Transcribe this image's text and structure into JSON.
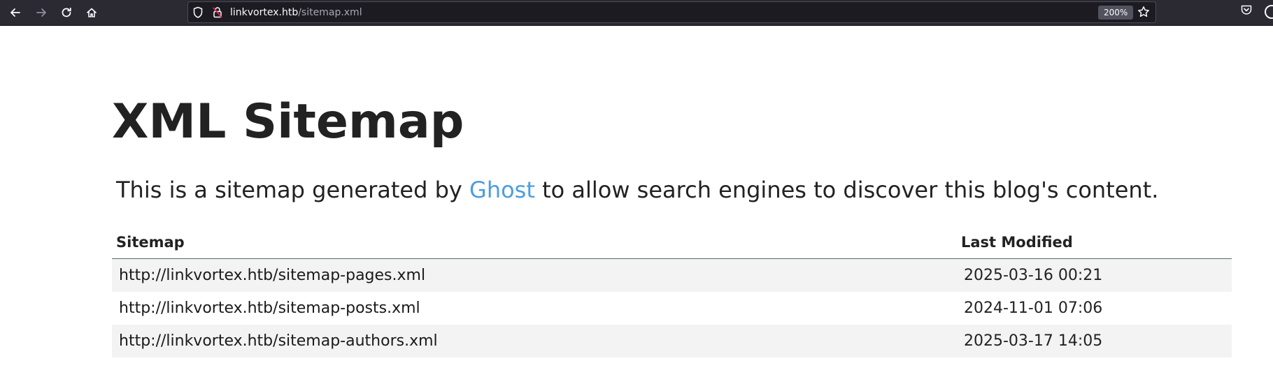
{
  "browser": {
    "url_host": "linkvortex.htb",
    "url_path": "/sitemap.xml",
    "zoom_level": "200%",
    "icons": {
      "back": "back-arrow-icon",
      "forward": "forward-arrow-icon",
      "reload": "reload-icon",
      "home": "home-icon",
      "tracking": "shield-icon",
      "security": "lock-warning-icon",
      "bookmark": "star-icon",
      "pocket": "pocket-icon"
    }
  },
  "page": {
    "title": "XML Sitemap",
    "intro_before": "This is a sitemap generated by ",
    "intro_link": "Ghost",
    "intro_after": " to allow search engines to discover this blog's content.",
    "link_color": "#4a9ee3"
  },
  "table": {
    "headers": {
      "sitemap": "Sitemap",
      "last_modified": "Last Modified"
    },
    "rows": [
      {
        "url": "http://linkvortex.htb/sitemap-pages.xml",
        "modified": "2025-03-16 00:21"
      },
      {
        "url": "http://linkvortex.htb/sitemap-posts.xml",
        "modified": "2024-11-01 07:06"
      },
      {
        "url": "http://linkvortex.htb/sitemap-authors.xml",
        "modified": "2025-03-17 14:05"
      }
    ]
  }
}
